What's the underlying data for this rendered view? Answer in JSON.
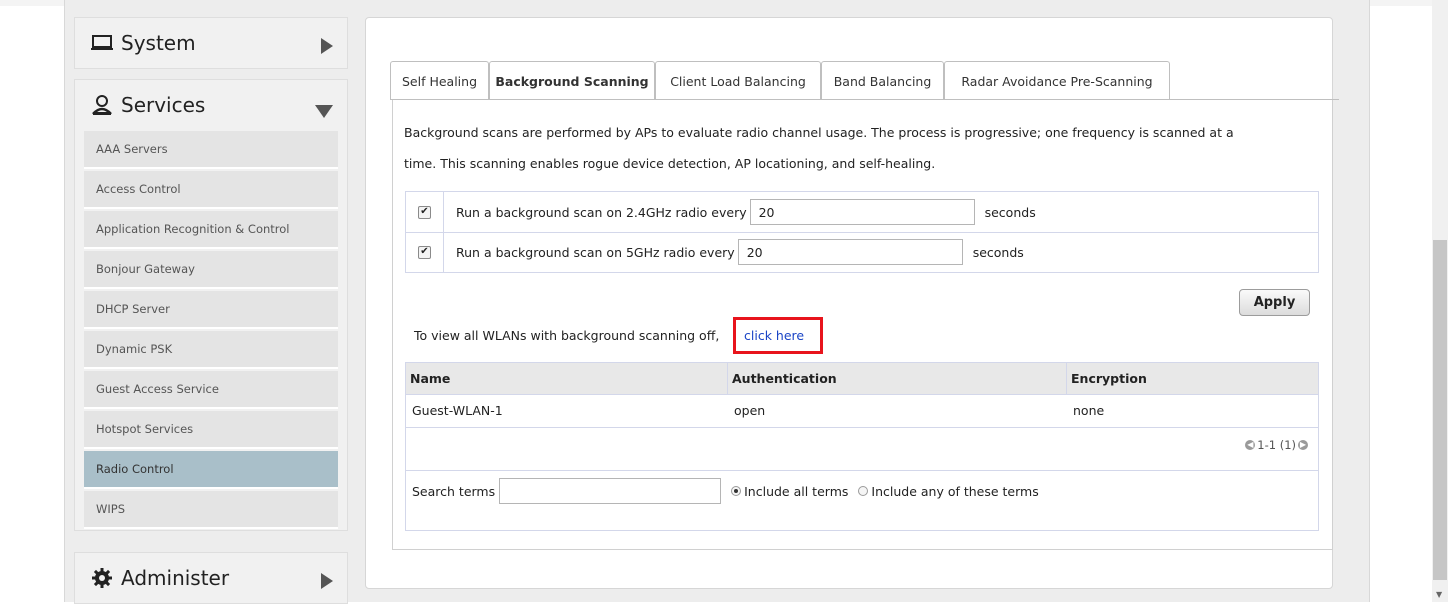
{
  "sidebar": {
    "system_label": "System",
    "services_label": "Services",
    "administer_label": "Administer",
    "items": [
      {
        "label": "AAA Servers",
        "active": false
      },
      {
        "label": "Access Control",
        "active": false
      },
      {
        "label": "Application Recognition & Control",
        "active": false
      },
      {
        "label": "Bonjour Gateway",
        "active": false
      },
      {
        "label": "DHCP Server",
        "active": false
      },
      {
        "label": "Dynamic PSK",
        "active": false
      },
      {
        "label": "Guest Access Service",
        "active": false
      },
      {
        "label": "Hotspot Services",
        "active": false
      },
      {
        "label": "Radio Control",
        "active": true
      },
      {
        "label": "WIPS",
        "active": false
      }
    ],
    "active_color": "#a9bfc9"
  },
  "tabs": [
    {
      "label": "Self Healing",
      "active": false
    },
    {
      "label": "Background Scanning",
      "active": true
    },
    {
      "label": "Client Load Balancing",
      "active": false
    },
    {
      "label": "Band Balancing",
      "active": false
    },
    {
      "label": "Radar Avoidance Pre-Scanning",
      "active": false
    }
  ],
  "description": {
    "line1": "Background scans are performed by APs to evaluate radio channel usage. The process is progressive; one frequency is scanned at a",
    "line2": "time. This scanning enables rogue device detection, AP locationing, and self-healing."
  },
  "scan": {
    "row24": {
      "checked": true,
      "label": "Run a background scan on 2.4GHz radio every",
      "value": "20",
      "unit": "seconds"
    },
    "row5": {
      "checked": true,
      "label": "Run a background scan on 5GHz radio every",
      "value": "20",
      "unit": "seconds"
    }
  },
  "apply_label": "Apply",
  "wlan_off": {
    "text": "To view all WLANs with background scanning off,",
    "link": "click here",
    "highlight_color": "#e8141c"
  },
  "table": {
    "columns": [
      "Name",
      "Authentication",
      "Encryption"
    ],
    "rows": [
      {
        "name": "Guest-WLAN-1",
        "authentication": "open",
        "encryption": "none"
      }
    ],
    "pager": "1-1 (1)",
    "search_label": "Search terms",
    "search_value": "",
    "radio_all": "Include all terms",
    "radio_any": "Include any of these terms",
    "radio_selected": "all"
  }
}
